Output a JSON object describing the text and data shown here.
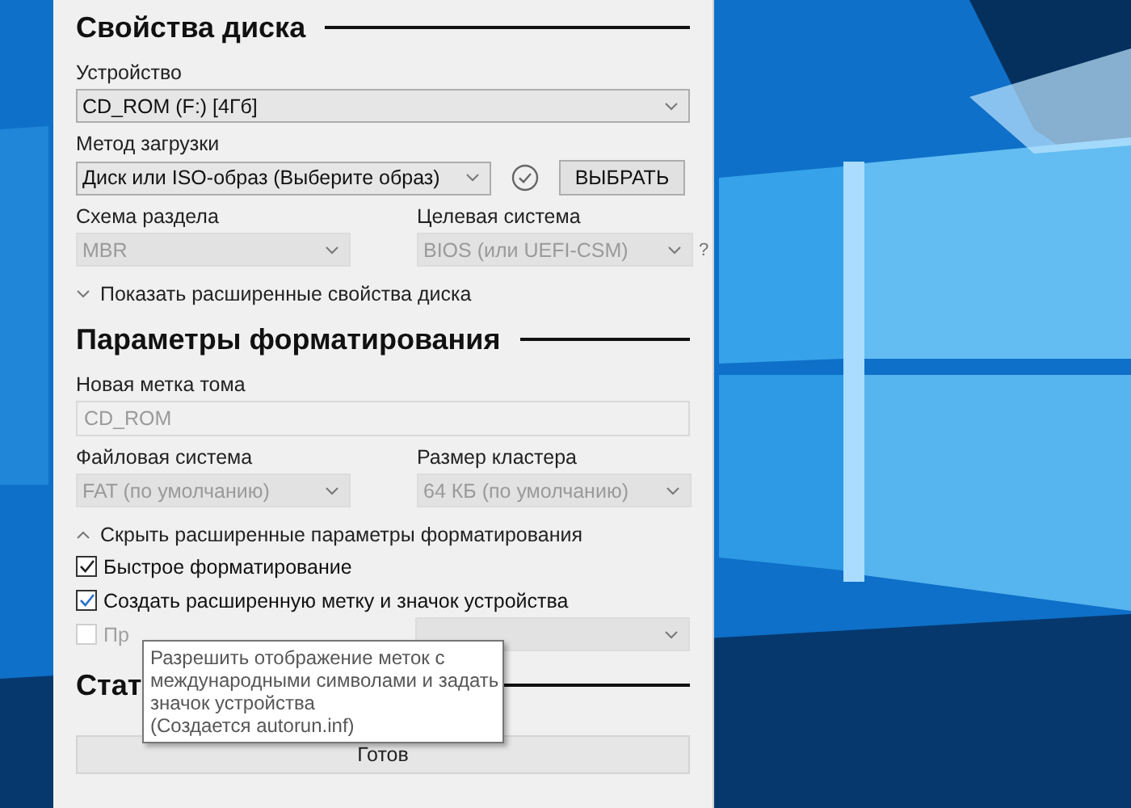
{
  "disk_properties": {
    "heading": "Свойства диска",
    "device": {
      "label": "Устройство",
      "value": "CD_ROM (F:) [4Гб]",
      "disabled": false
    },
    "boot": {
      "label": "Метод загрузки",
      "value": "Диск или ISO-образ (Выберите образ)",
      "disabled": false,
      "button": "ВЫБРАТЬ"
    },
    "partition": {
      "label": "Схема раздела",
      "value": "MBR",
      "disabled": true
    },
    "target": {
      "label": "Целевая система",
      "value": "BIOS (или UEFI-CSM)",
      "disabled": true,
      "help": "?"
    },
    "toggle": {
      "label": "Показать расширенные свойства диска",
      "expanded": false
    }
  },
  "format_options": {
    "heading": "Параметры форматирования",
    "volume": {
      "label": "Новая метка тома",
      "value": "CD_ROM",
      "disabled": true
    },
    "filesystem": {
      "label": "Файловая система",
      "value": "FAT (по умолчанию)",
      "disabled": true
    },
    "cluster": {
      "label": "Размер кластера",
      "value": "64 КБ (по умолчанию)",
      "disabled": true
    },
    "toggle": {
      "label": "Скрыть расширенные параметры форматирования",
      "expanded": true
    },
    "checkboxes": [
      {
        "label": "Быстрое форматирование",
        "checked": true,
        "disabled": false
      },
      {
        "label": "Создать расширенную метку и значок устройства",
        "checked": true,
        "disabled": false
      },
      {
        "label": "Пр",
        "checked": false,
        "disabled": true
      }
    ],
    "extra_select": {
      "disabled": true
    }
  },
  "status": {
    "heading": "Стат",
    "text": "Готов"
  },
  "tooltip": {
    "lines": [
      "Разрешить отображение меток с",
      "международными символами и задать",
      "значок устройства",
      "(Создается autorun.inf)"
    ]
  }
}
